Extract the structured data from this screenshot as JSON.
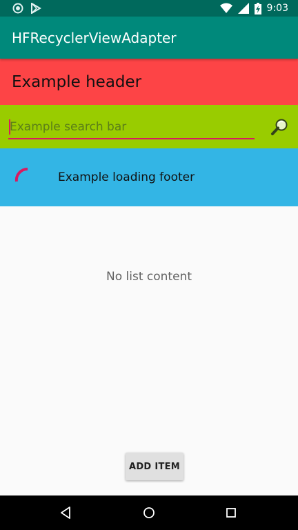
{
  "status_bar": {
    "time": "9:03",
    "left_icons": [
      "sync-circle-icon",
      "play-store-icon"
    ],
    "right_icons": [
      "wifi-icon",
      "signal-icon",
      "battery-charging-icon"
    ]
  },
  "app_bar": {
    "title": "HFRecyclerViewAdapter"
  },
  "header": {
    "text": "Example header",
    "background": "#fd4446"
  },
  "search": {
    "placeholder": "Example search bar",
    "value": "",
    "background": "#99cc00",
    "icon": "search-icon"
  },
  "footer": {
    "text": "Example loading footer",
    "background": "#33b5e5",
    "spinner_color": "#d81b60"
  },
  "list": {
    "empty_text": "No list content"
  },
  "actions": {
    "add_item_label": "ADD ITEM"
  },
  "nav_bar": {
    "items": [
      "back-icon",
      "home-icon",
      "recents-icon"
    ]
  },
  "colors": {
    "primary": "#00897b",
    "primary_dark": "#00695c",
    "accent": "#d81b60"
  }
}
